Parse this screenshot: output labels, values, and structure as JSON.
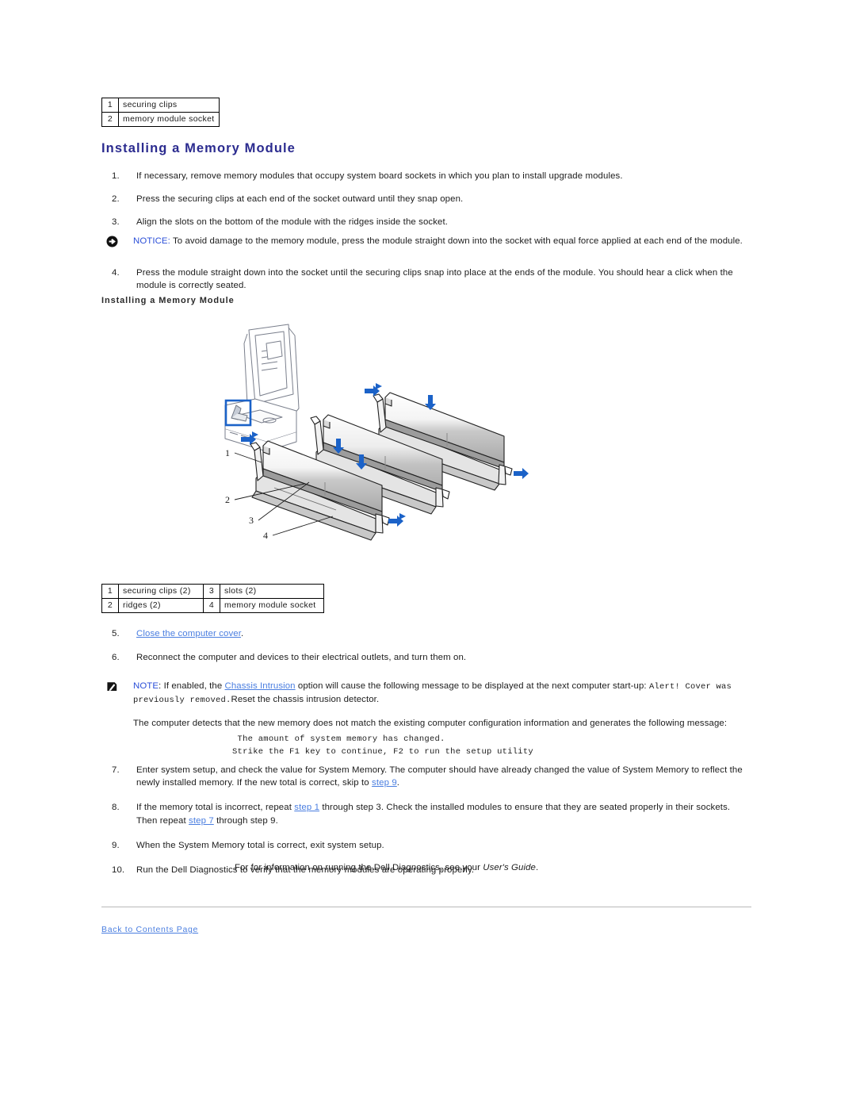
{
  "document": {
    "section_heading": "Installing a Memory Module",
    "figure_caption": "Installing a Memory Module"
  },
  "top_callout_table": {
    "rows": [
      {
        "num": "1",
        "label": "securing clips"
      },
      {
        "num": "2",
        "label": "memory module socket"
      }
    ]
  },
  "bottom_callout_table": {
    "rows": [
      {
        "num1": "1",
        "label1": "securing clips (2)",
        "num2": "3",
        "label2": "slots (2)"
      },
      {
        "num1": "2",
        "label1": "ridges (2)",
        "num2": "4",
        "label2": "memory module socket"
      }
    ]
  },
  "steps_first": [
    {
      "mark": "1.",
      "text": "If necessary, remove memory modules that occupy system board sockets in which you plan to install upgrade modules."
    },
    {
      "mark": "2.",
      "text": "Press the securing clips at each end of the socket outward until they snap open."
    },
    {
      "mark": "3.",
      "text": "Align the slots on the bottom of the module with the ridges inside the socket."
    }
  ],
  "notice": {
    "icon": "notice-arrow-icon",
    "lead": "NOTICE:",
    "text": " To avoid damage to the memory module, press the module straight down into the socket with equal force applied at each end of the module."
  },
  "steps_second": [
    {
      "mark": "4.",
      "text": "Press the module straight down into the socket until the securing clips snap into place at the ends of the module. You should hear a click when the module is correctly seated."
    }
  ],
  "steps_third": {
    "step5": {
      "mark": "5.",
      "link": "Close the computer cover",
      "tail": "."
    },
    "step6": {
      "mark": "6.",
      "text": "Reconnect the computer and devices to their electrical outlets, and turn them on."
    }
  },
  "note": {
    "icon": "note-pencil-icon",
    "lead": "NOTE",
    "text_a": ": If enabled, the ",
    "link": "Chassis Intrusion",
    "text_b": " option will cause the following message to be displayed at the next computer start-up: ",
    "mono_a": "Alert! Cover was previously removed.",
    "text_c": "Reset the chassis intrusion detector."
  },
  "detect_paragraph": "The computer detects that the new memory does not match the existing computer configuration information and generates the following message:",
  "system_message": " The amount of system memory has changed.\nStrike the F1 key to continue, F2 to run the setup utility",
  "steps_fourth": {
    "step7": {
      "mark": "7.",
      "text_a": "Enter system setup, and check the value for System Memory. The computer should have already changed the value of System Memory to reflect the newly installed memory. If the new total is correct, skip to ",
      "link": "step 9",
      "text_b": "."
    },
    "step8": {
      "mark": "8.",
      "text_a": "If the memory total is incorrect, repeat ",
      "link_a": "step 1",
      "text_b": " through step 3. Check the installed modules to ensure that they are seated properly in their sockets. Then repeat ",
      "link_b": "step 7",
      "text_c": " through step 9."
    },
    "step9": {
      "mark": "9.",
      "text": "When the System Memory total is correct, exit system setup."
    },
    "step10": {
      "mark": "10.",
      "text": "Run the Dell Diagnostics to verify that the memory modules are operating properly."
    }
  },
  "guide_paragraph": {
    "text_a": "For for information on running the Dell Diagnostics, see your ",
    "italic": "User's Guide",
    "text_b": "."
  },
  "footer": {
    "back_link": "Back to Contents Page"
  },
  "figure": {
    "alt": "Installing a memory module into the memory module socket",
    "callouts": [
      "1",
      "2",
      "3",
      "4"
    ],
    "accent_color": "#1b62c8",
    "line_color": "#1c1c1c"
  }
}
